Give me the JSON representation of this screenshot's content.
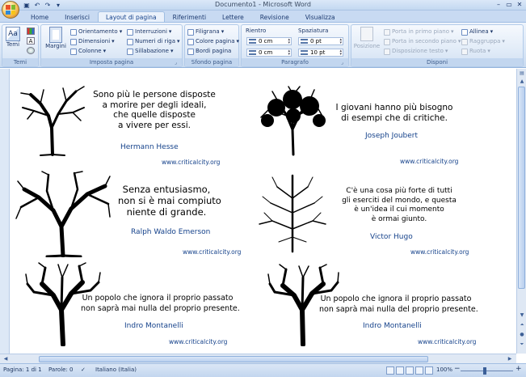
{
  "window": {
    "title": "Documento1 - Microsoft Word"
  },
  "quick_access": [
    {
      "name": "save-icon",
      "glyph": "▣"
    },
    {
      "name": "undo-icon",
      "glyph": "↶"
    },
    {
      "name": "redo-icon",
      "glyph": "↷"
    },
    {
      "name": "qat-menu-icon",
      "glyph": "▾"
    }
  ],
  "tabs": [
    "Home",
    "Inserisci",
    "Layout di pagina",
    "Riferimenti",
    "Lettere",
    "Revisione",
    "Visualizza"
  ],
  "active_tab": "Layout di pagina",
  "ribbon": {
    "temi": {
      "label": "Temi",
      "temi_button": "Temi"
    },
    "imposta_pagina": {
      "label": "Imposta pagina",
      "margini": "Margini",
      "orientamento": "Orientamento",
      "dimensioni": "Dimensioni",
      "colonne": "Colonne",
      "interruzioni": "Interruzioni",
      "numeri_di_riga": "Numeri di riga",
      "sillabazione": "Sillabazione"
    },
    "sfondo_pagina": {
      "label": "Sfondo pagina",
      "filigrana": "Filigrana",
      "colore_pagina": "Colore pagina",
      "bordi_pagina": "Bordi pagina"
    },
    "paragrafo": {
      "label": "Paragrafo",
      "rientro": "Rientro",
      "spaziatura": "Spaziatura",
      "rientro_sx": "0 cm",
      "rientro_dx": "0 cm",
      "spaziatura_prima": "0 pt",
      "spaziatura_dopo": "10 pt"
    },
    "disponi": {
      "label": "Disponi",
      "posizione": "Posizione",
      "porta_primo_piano": "Porta in primo piano",
      "porta_secondo_piano": "Porta in secondo piano",
      "disposizione_testo": "Disposizione testo",
      "allinea": "Allinea",
      "raggruppa": "Raggruppa",
      "ruota": "Ruota"
    }
  },
  "quotes": [
    {
      "lines": [
        "Sono più le persone disposte",
        "a morire per degli ideali,",
        "che quelle disposte",
        "a vivere per essi."
      ],
      "author": "Hermann Hesse",
      "url": "www.criticalcity.org"
    },
    {
      "lines": [
        "I giovani hanno più bisogno",
        "di esempi che di critiche."
      ],
      "author": "Joseph Joubert",
      "url": "www.criticalcity.org"
    },
    {
      "lines": [
        "Senza entusiasmo,",
        "non si è mai compiuto",
        "niente di grande."
      ],
      "author": "Ralph Waldo Emerson",
      "url": "www.criticalcity.org"
    },
    {
      "lines": [
        "C'è una cosa più forte di tutti",
        "gli eserciti del mondo, e questa",
        "è un'idea il cui momento",
        "è ormai giunto."
      ],
      "author": "Victor Hugo",
      "url": "www.criticalcity.org"
    },
    {
      "lines": [
        "Un popolo che ignora il proprio passato",
        "non saprà mai nulla del proprio presente."
      ],
      "author": "Indro Montanelli",
      "url": "www.criticalcity.org"
    },
    {
      "lines": [
        "Un popolo che ignora il proprio passato",
        "non saprà mai nulla del proprio presente."
      ],
      "author": "Indro Montanelli",
      "url": "www.criticalcity.org"
    }
  ],
  "statusbar": {
    "pagina": "Pagina: 1 di 1",
    "parole": "Parole: 0",
    "lingua": "Italiano (Italia)",
    "zoom": "100%"
  }
}
